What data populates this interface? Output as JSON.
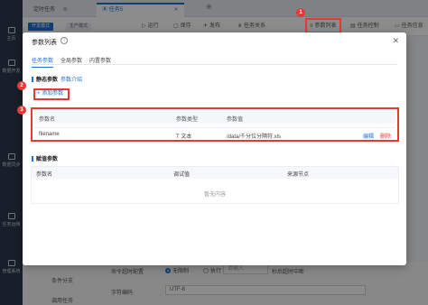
{
  "left_nav": {
    "items": [
      {
        "label": "主页"
      },
      {
        "label": "数据开发"
      },
      {
        "label": "数据同步"
      },
      {
        "label": "任务运维"
      },
      {
        "label": "管理系统"
      }
    ]
  },
  "tabs": [
    {
      "label": "定时任务"
    },
    {
      "label": "任务5"
    }
  ],
  "toolbar": {
    "mode_dev": "开发模式",
    "mode_prod": "生产模式",
    "items": [
      {
        "label": "运行"
      },
      {
        "label": "保存"
      },
      {
        "label": "发布"
      },
      {
        "label": "任务关系"
      },
      {
        "label": "参数列表"
      },
      {
        "label": "任务控制"
      },
      {
        "label": "任务信息"
      }
    ]
  },
  "modal": {
    "title": "参数列表",
    "tabs": [
      "任务参数",
      "全局参数",
      "内置参数"
    ],
    "static_section": {
      "title": "静态参数",
      "intro_link": "参数介绍"
    },
    "add_button": "添加参数",
    "params_table": {
      "headers": [
        "参数名",
        "参数类型",
        "参数值"
      ],
      "rows": [
        {
          "name": "filename",
          "type": "文本",
          "value": "/data/千分位分隔符.xls",
          "edit": "编辑",
          "delete": "删除"
        }
      ]
    },
    "assign_section": {
      "title": "赋值参数"
    },
    "assign_table": {
      "headers": [
        "参数名",
        "调试值",
        "来源节点"
      ],
      "empty_text": "暂无内容"
    }
  },
  "background_form": {
    "timeout_label": "命令超时配置",
    "unlimited": "无限制",
    "execute": "执行",
    "input_placeholder": "请输入",
    "timeout_suffix": "秒后超时中断",
    "encoding_label": "字符编码",
    "encoding_value": "UTF-8",
    "node1": "条件分支",
    "node2": "调用任务"
  },
  "annotations": [
    "1",
    "2",
    "3"
  ],
  "colors": {
    "accent": "#1f6fd6",
    "highlight": "#e53935"
  }
}
